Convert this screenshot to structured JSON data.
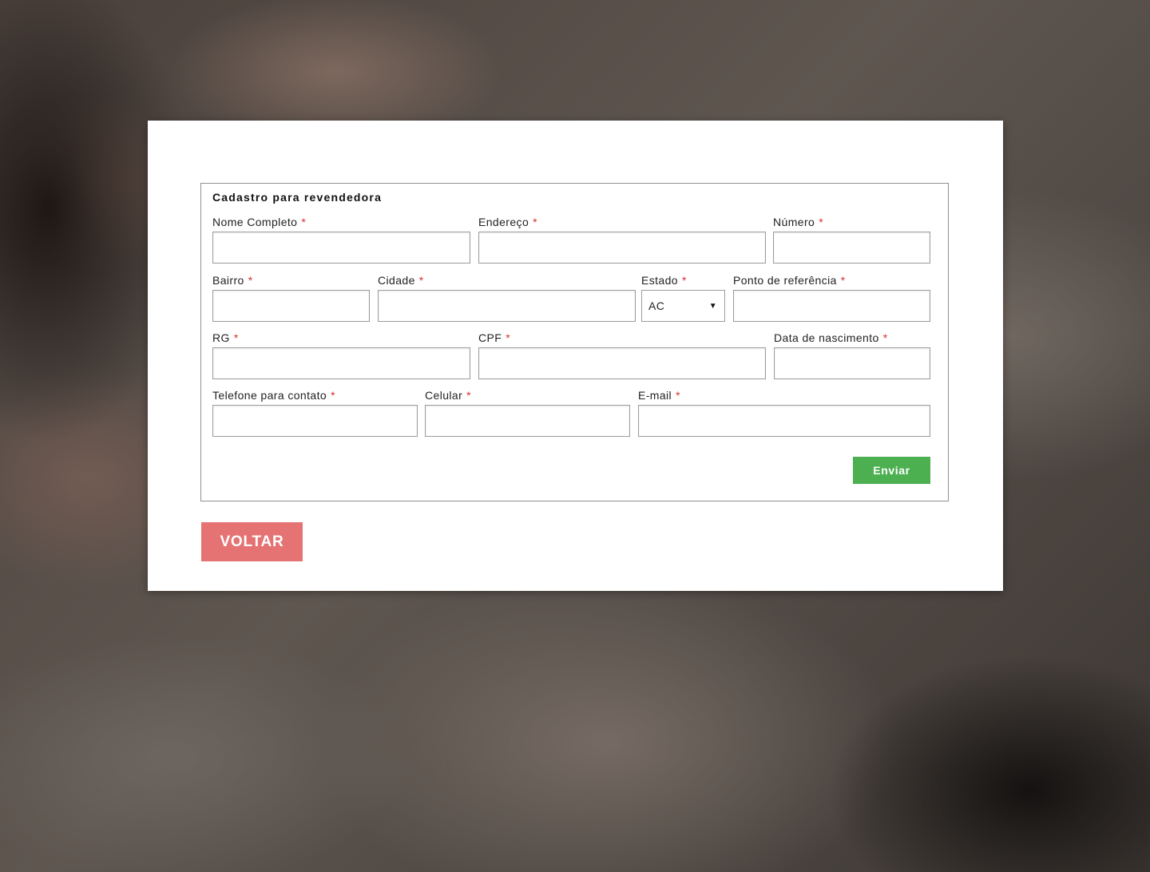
{
  "form": {
    "legend": "Cadastro para revendedora",
    "required_mark": "*",
    "fields": {
      "nome": {
        "label": "Nome Completo",
        "value": ""
      },
      "endereco": {
        "label": "Endereço",
        "value": ""
      },
      "numero": {
        "label": "Número",
        "value": ""
      },
      "bairro": {
        "label": "Bairro",
        "value": ""
      },
      "cidade": {
        "label": "Cidade",
        "value": ""
      },
      "estado": {
        "label": "Estado",
        "selected": "AC"
      },
      "referencia": {
        "label": "Ponto de referência",
        "value": ""
      },
      "rg": {
        "label": "RG",
        "value": ""
      },
      "cpf": {
        "label": "CPF",
        "value": ""
      },
      "nascimento": {
        "label": "Data de nascimento",
        "value": ""
      },
      "telefone": {
        "label": "Telefone para contato",
        "value": ""
      },
      "celular": {
        "label": "Celular",
        "value": ""
      },
      "email": {
        "label": "E-mail",
        "value": ""
      }
    },
    "submit_label": "Enviar"
  },
  "back_label": "VOLTAR",
  "icons": {
    "select_arrow": "caret-down-icon"
  },
  "colors": {
    "submit": "#4caf50",
    "back": "#e57373",
    "required": "#d9302e"
  }
}
